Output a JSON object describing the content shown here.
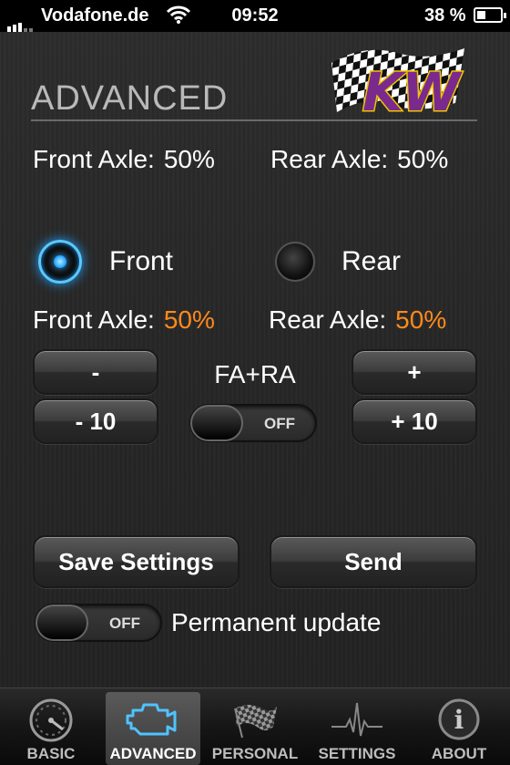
{
  "status_bar": {
    "carrier": "Vodafone.de",
    "time": "09:52",
    "battery": "38 %",
    "battery_level": 0.38
  },
  "header": {
    "title": "ADVANCED",
    "logo_text": "KW"
  },
  "current": {
    "front_label": "Front Axle:",
    "front_value": "50%",
    "rear_label": "Rear Axle:",
    "rear_value": "50%"
  },
  "axle_select": {
    "front_label": "Front",
    "rear_label": "Rear",
    "selected": "front"
  },
  "target": {
    "front_label": "Front Axle:",
    "front_value": "50%",
    "rear_label": "Rear Axle:",
    "rear_value": "50%"
  },
  "controls": {
    "minus_label": "-",
    "minus10_label": "- 10",
    "plus_label": "+",
    "plus10_label": "+ 10",
    "fara_label": "FA+RA",
    "fara_toggle": "OFF"
  },
  "actions": {
    "save_label": "Save Settings",
    "send_label": "Send",
    "permanent_toggle": "OFF",
    "permanent_label": "Permanent update"
  },
  "tabs": [
    {
      "label": "BASIC",
      "icon": "speedometer-icon"
    },
    {
      "label": "ADVANCED",
      "icon": "engine-icon",
      "active": true
    },
    {
      "label": "PERSONAL",
      "icon": "checkered-flag-icon"
    },
    {
      "label": "SETTINGS",
      "icon": "pulse-icon"
    },
    {
      "label": "ABOUT",
      "icon": "info-icon"
    }
  ],
  "colors": {
    "accent_orange": "#ff8a1c",
    "radio_blue": "#1ea0ff",
    "logo_purple": "#7a2a8c",
    "logo_yellow": "#f0c400"
  }
}
